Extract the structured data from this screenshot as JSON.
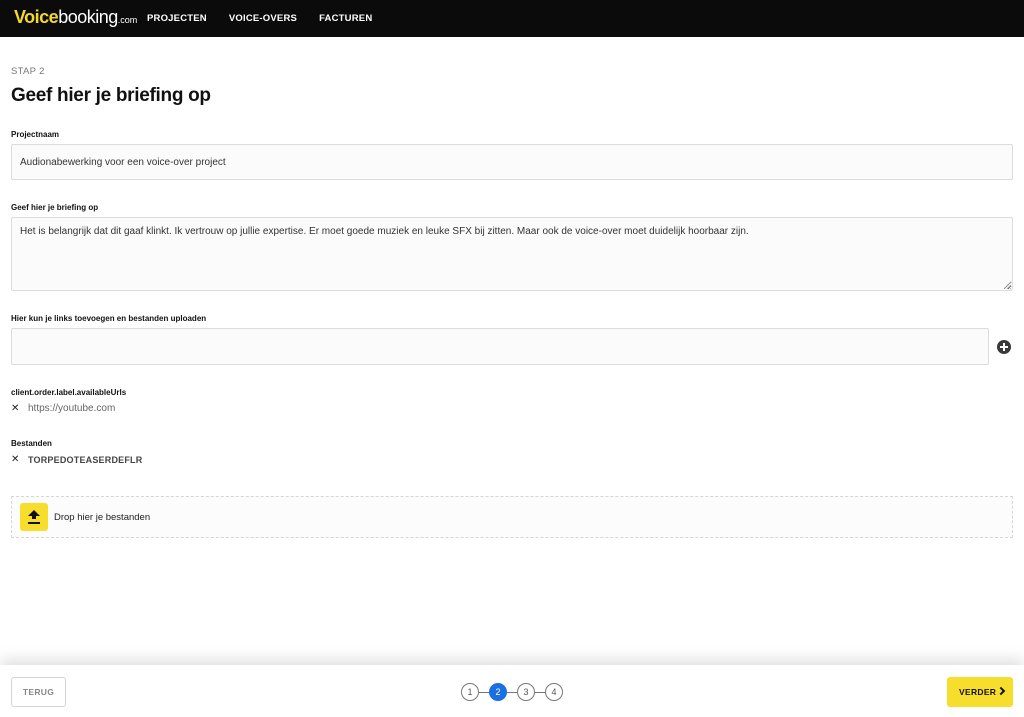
{
  "header": {
    "logo": {
      "part1": "Voice",
      "part2": "booking",
      "part3": ".com"
    },
    "nav": [
      "PROJECTEN",
      "VOICE-OVERS",
      "FACTUREN"
    ]
  },
  "step_label": "STAP 2",
  "page_title": "Geef hier je briefing op",
  "form": {
    "project_name_label": "Projectnaam",
    "project_name_value": "Audionabewerking voor een voice-over project",
    "briefing_label": "Geef hier je briefing op",
    "briefing_value": "Het is belangrijk dat dit gaaf klinkt. Ik vertrouw op jullie expertise. Er moet goede muziek en leuke SFX bij zitten. Maar ook de voice-over moet duidelijk hoorbaar zijn.",
    "links_label": "Hier kun je links toevoegen en bestanden uploaden",
    "links_value": "",
    "available_urls_label": "client.order.label.availableUrls",
    "urls": [
      "https://youtube.com"
    ],
    "files_label": "Bestanden",
    "files": [
      "TORPEDOTEASERDEFLR"
    ],
    "dropzone_text": "Drop hier je bestanden"
  },
  "footer": {
    "back_label": "TERUG",
    "steps": [
      "1",
      "2",
      "3",
      "4"
    ],
    "active_step": 2,
    "next_label": "VERDER"
  },
  "colors": {
    "brand_yellow": "#f7de2c",
    "active_step": "#1c6fe0",
    "topbar": "#0b0b0b"
  },
  "icons": [
    "plus-circle-icon",
    "close-icon",
    "upload-icon",
    "chevron-right-icon"
  ]
}
